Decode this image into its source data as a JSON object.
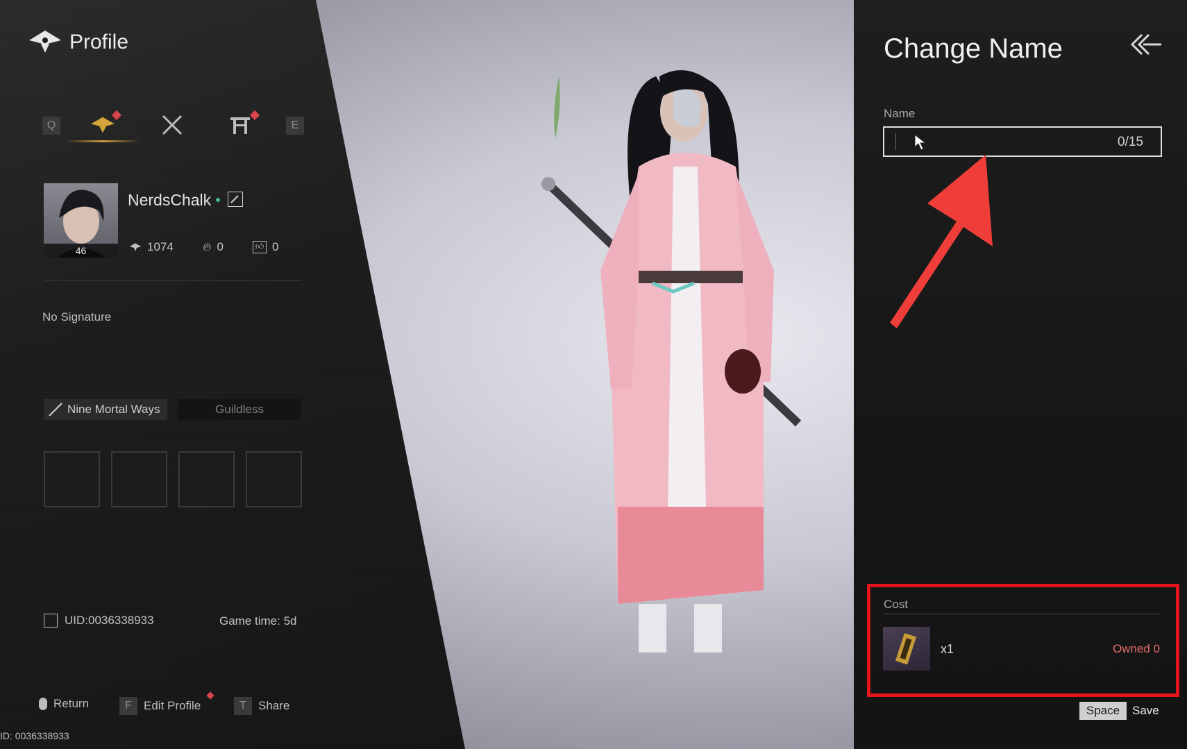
{
  "profile": {
    "title": "Profile",
    "tabs": {
      "prev_key": "Q",
      "next_key": "E"
    },
    "player": {
      "name": "NerdsChalk",
      "level": "46",
      "stats": {
        "score": "1074",
        "fire": "0",
        "likes": "0"
      }
    },
    "signature": "No Signature",
    "sect": "Nine Mortal Ways",
    "guild": "Guildless",
    "uid": "UID:0036338933",
    "game_time": "Game time: 5d",
    "actions": {
      "return": "Return",
      "edit_key": "F",
      "edit": "Edit Profile",
      "share_key": "T",
      "share": "Share"
    },
    "id_footer": "ID: 0036338933"
  },
  "change_name": {
    "title": "Change Name",
    "name_label": "Name",
    "input_value": "",
    "counter": "0/15",
    "cost_label": "Cost",
    "cost_qty": "x1",
    "owned": "Owned 0",
    "confirm_key": "Space",
    "confirm_label": "Save"
  },
  "colors": {
    "accent_gold": "#c99a3a",
    "notification_red": "#d8454a",
    "annotation_red": "#e3151b",
    "owned_red": "#e26b6b"
  }
}
